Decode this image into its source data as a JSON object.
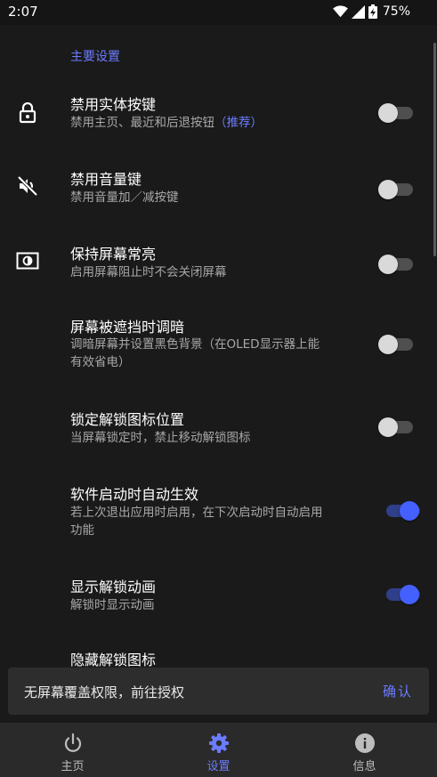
{
  "status_bar": {
    "time": "2:07",
    "battery": "75%"
  },
  "section": {
    "title": "主要设置"
  },
  "settings": [
    {
      "title": "禁用实体按键",
      "subtitle": "禁用主页、最近和后退按钮",
      "subtitle_highlight": "（推荐）",
      "icon": "lock-icon",
      "enabled": false
    },
    {
      "title": "禁用音量键",
      "subtitle": "禁用音量加／减按键",
      "icon": "volume-off-icon",
      "enabled": false
    },
    {
      "title": "保持屏幕常亮",
      "subtitle": "启用屏幕阻止时不会关闭屏幕",
      "icon": "screen-brightness-icon",
      "enabled": false
    },
    {
      "title": "屏幕被遮挡时调暗",
      "subtitle": "调暗屏幕并设置黑色背景（在OLED显示器上能",
      "subtitle2": "有效省电）",
      "enabled": false
    },
    {
      "title": "锁定解锁图标位置",
      "subtitle": "当屏幕锁定时，禁止移动解锁图标",
      "enabled": false
    },
    {
      "title": "软件启动时自动生效",
      "subtitle": "若上次退出应用时启用，在下次启动时自动启用",
      "subtitle2": "功能",
      "enabled": true
    },
    {
      "title": "显示解锁动画",
      "subtitle": "解锁时显示动画",
      "enabled": true
    },
    {
      "title": "隐藏解锁图标"
    }
  ],
  "snackbar": {
    "message": "无屏幕覆盖权限，前往授权",
    "action": "确认"
  },
  "bottom_nav": [
    {
      "label": "主页",
      "icon": "power-icon",
      "active": false
    },
    {
      "label": "设置",
      "icon": "gear-icon",
      "active": true
    },
    {
      "label": "信息",
      "icon": "info-icon",
      "active": false
    }
  ],
  "colors": {
    "accent": "#6b7cff",
    "background": "#1a1a1a",
    "switch_on": "#4460ff"
  }
}
